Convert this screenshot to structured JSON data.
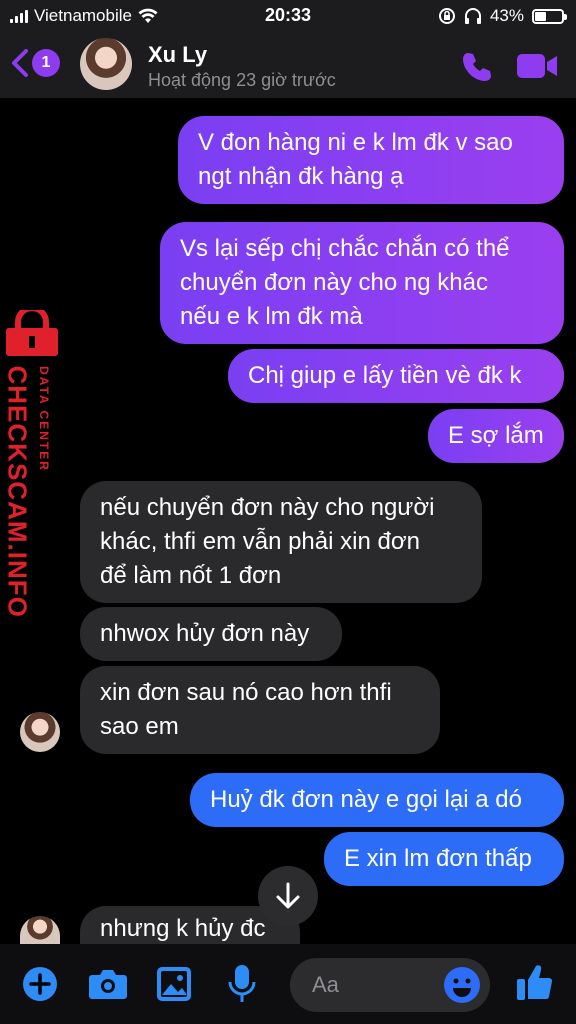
{
  "status_bar": {
    "carrier": "Vietnamobile",
    "time": "20:33",
    "battery": "43%",
    "battery_level": 0.43
  },
  "header": {
    "back_count": "1",
    "name": "Xu Ly",
    "status": "Hoạt động 23 giờ trước"
  },
  "watermark": {
    "brand": "CHECKSCAM.INFO",
    "sub": "DATA CENTER"
  },
  "messages": [
    {
      "side": "out",
      "lines": [
        "V đon hàng ni e k lm đk v sao",
        "ngt nhận đk hàng ạ"
      ]
    },
    {
      "side": "out",
      "lines": [
        "Vs lại sếp chị chắc chắn có thể",
        "chuyển đơn này cho ng khác",
        "nếu e k lm đk mà"
      ]
    },
    {
      "side": "out",
      "lines": [
        "Chị giup e lấy tiền vè đk k"
      ]
    },
    {
      "side": "out",
      "lines": [
        "E sợ lắm"
      ]
    },
    {
      "side": "in",
      "lines": [
        "nếu chuyển đơn này cho người",
        "khác, thfi em vẫn phải xin đơn",
        "để làm nốt 1 đơn"
      ]
    },
    {
      "side": "in",
      "lines": [
        "nhwox hủy đơn này"
      ]
    },
    {
      "side": "in",
      "lines": [
        "xin đơn sau nó cao hơn thfi",
        "sao em"
      ]
    },
    {
      "side": "out",
      "lines": [
        "Huỷ đk đơn này e gọi lại a dó"
      ]
    },
    {
      "side": "out",
      "lines": [
        "E xin lm đơn thấp"
      ]
    },
    {
      "side": "in",
      "lines": [
        "nhưng k hủy đc"
      ]
    }
  ],
  "composer": {
    "placeholder": "Aa"
  },
  "colors": {
    "accent": "#8e3cf0",
    "outgoing": "#8a3ff0",
    "outgoing_blue": "#2d6cf6",
    "incoming": "#2a2a2c",
    "icon_blue": "#2d8cf6"
  }
}
